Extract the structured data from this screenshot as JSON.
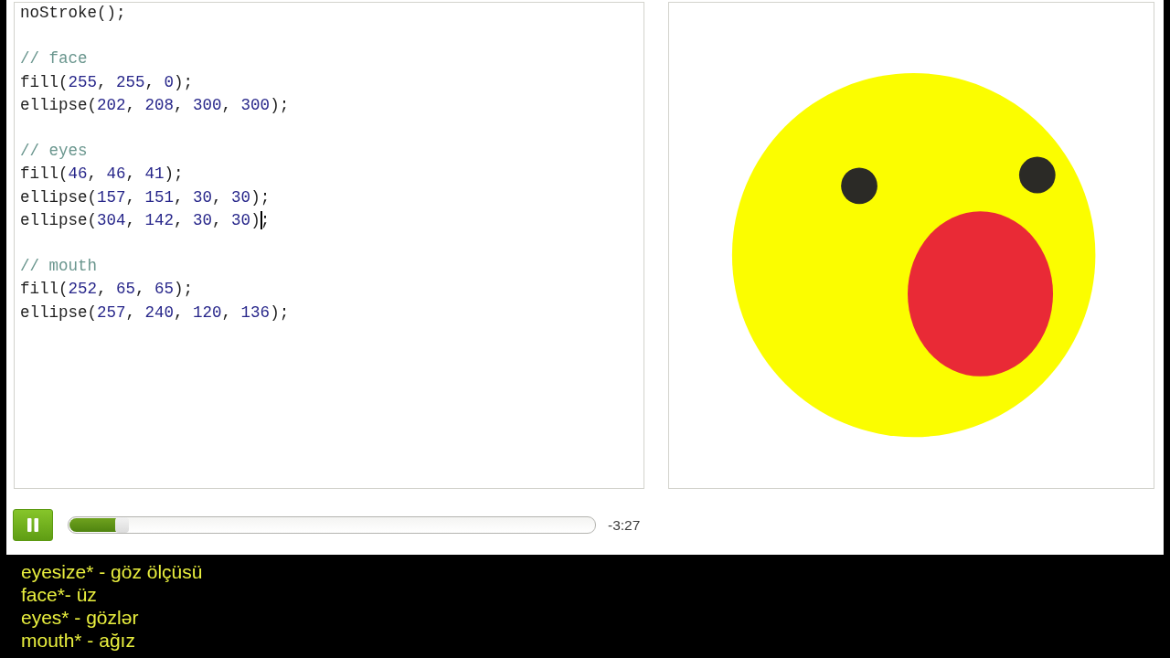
{
  "code_editor": {
    "blocks": [
      {
        "lines": [
          {
            "tokens": [
              {
                "kind": "plain",
                "text": "noStroke();"
              }
            ]
          }
        ]
      },
      {
        "lines": [
          {
            "tokens": [
              {
                "kind": "comment",
                "text": "// face"
              }
            ]
          },
          {
            "tokens": [
              {
                "kind": "plain",
                "text": "fill("
              },
              {
                "kind": "number",
                "text": "255"
              },
              {
                "kind": "plain",
                "text": ", "
              },
              {
                "kind": "number",
                "text": "255"
              },
              {
                "kind": "plain",
                "text": ", "
              },
              {
                "kind": "number",
                "text": "0"
              },
              {
                "kind": "plain",
                "text": ");"
              }
            ]
          },
          {
            "tokens": [
              {
                "kind": "plain",
                "text": "ellipse("
              },
              {
                "kind": "number",
                "text": "202"
              },
              {
                "kind": "plain",
                "text": ", "
              },
              {
                "kind": "number",
                "text": "208"
              },
              {
                "kind": "plain",
                "text": ", "
              },
              {
                "kind": "number",
                "text": "300"
              },
              {
                "kind": "plain",
                "text": ", "
              },
              {
                "kind": "number",
                "text": "300"
              },
              {
                "kind": "plain",
                "text": ");"
              }
            ]
          }
        ]
      },
      {
        "lines": [
          {
            "tokens": [
              {
                "kind": "comment",
                "text": "// eyes"
              }
            ]
          },
          {
            "tokens": [
              {
                "kind": "plain",
                "text": "fill("
              },
              {
                "kind": "number",
                "text": "46"
              },
              {
                "kind": "plain",
                "text": ", "
              },
              {
                "kind": "number",
                "text": "46"
              },
              {
                "kind": "plain",
                "text": ", "
              },
              {
                "kind": "number",
                "text": "41"
              },
              {
                "kind": "plain",
                "text": ");"
              }
            ]
          },
          {
            "tokens": [
              {
                "kind": "plain",
                "text": "ellipse("
              },
              {
                "kind": "number",
                "text": "157"
              },
              {
                "kind": "plain",
                "text": ", "
              },
              {
                "kind": "number",
                "text": "151"
              },
              {
                "kind": "plain",
                "text": ", "
              },
              {
                "kind": "number",
                "text": "30"
              },
              {
                "kind": "plain",
                "text": ", "
              },
              {
                "kind": "number",
                "text": "30"
              },
              {
                "kind": "plain",
                "text": ");"
              }
            ]
          },
          {
            "tokens": [
              {
                "kind": "plain",
                "text": "ellipse("
              },
              {
                "kind": "number",
                "text": "304"
              },
              {
                "kind": "plain",
                "text": ", "
              },
              {
                "kind": "number",
                "text": "142"
              },
              {
                "kind": "plain",
                "text": ", "
              },
              {
                "kind": "number",
                "text": "30"
              },
              {
                "kind": "plain",
                "text": ", "
              },
              {
                "kind": "number",
                "text": "30"
              },
              {
                "kind": "plain",
                "text": ")"
              },
              {
                "kind": "cursor"
              },
              {
                "kind": "plain",
                "text": ";"
              }
            ]
          }
        ]
      },
      {
        "lines": [
          {
            "tokens": [
              {
                "kind": "comment",
                "text": "// mouth"
              }
            ]
          },
          {
            "tokens": [
              {
                "kind": "plain",
                "text": "fill("
              },
              {
                "kind": "number",
                "text": "252"
              },
              {
                "kind": "plain",
                "text": ", "
              },
              {
                "kind": "number",
                "text": "65"
              },
              {
                "kind": "plain",
                "text": ", "
              },
              {
                "kind": "number",
                "text": "65"
              },
              {
                "kind": "plain",
                "text": ");"
              }
            ]
          },
          {
            "tokens": [
              {
                "kind": "plain",
                "text": "ellipse("
              },
              {
                "kind": "number",
                "text": "257"
              },
              {
                "kind": "plain",
                "text": ", "
              },
              {
                "kind": "number",
                "text": "240"
              },
              {
                "kind": "plain",
                "text": ", "
              },
              {
                "kind": "number",
                "text": "120"
              },
              {
                "kind": "plain",
                "text": ", "
              },
              {
                "kind": "number",
                "text": "136"
              },
              {
                "kind": "plain",
                "text": ");"
              }
            ]
          }
        ]
      }
    ]
  },
  "player": {
    "playing": true,
    "progress": {
      "level": 0.1
    },
    "time_remaining": "-3:27"
  },
  "subtitles": [
    "eyesize* - göz ölçüsü",
    "face*- üz",
    "eyes* - gözlər",
    "mouth* - ağız"
  ]
}
